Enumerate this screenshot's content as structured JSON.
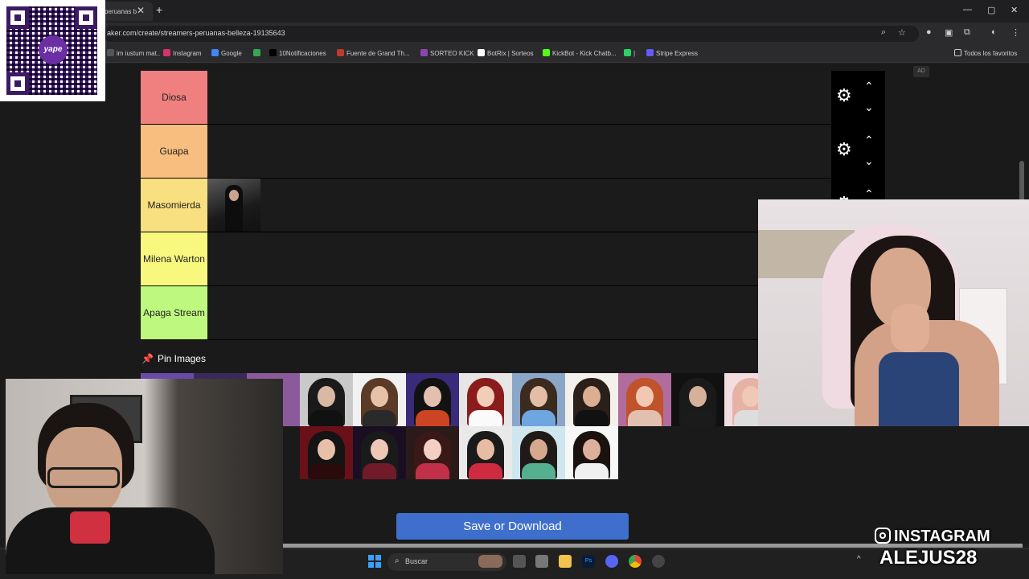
{
  "browser": {
    "tab_title": "peruanas b",
    "url": "aker.com/create/streamers-peruanas-belleza-19135643",
    "bookmarks": [
      {
        "label": "im iustum mat..",
        "color": "#555555"
      },
      {
        "label": "Instagram",
        "color": "#d6336c"
      },
      {
        "label": "Google",
        "color": "#4285f4"
      },
      {
        "label": "",
        "color": "#34a853"
      },
      {
        "label": "10Notificaciones",
        "color": "#000000"
      },
      {
        "label": "Fuente de Grand Th...",
        "color": "#c0392b"
      },
      {
        "label": "SORTEO KICK",
        "color": "#8e44ad"
      },
      {
        "label": "BotRix | Sorteos",
        "color": "#ffffff"
      },
      {
        "label": "KickBot - Kick Chatb...",
        "color": "#53fc18"
      },
      {
        "label": "|",
        "color": "#25d366"
      },
      {
        "label": "Stripe Express",
        "color": "#635bff"
      }
    ],
    "favorites_label": "Todos los favoritos"
  },
  "qr": {
    "logo_text": "yape"
  },
  "ad_label": "AD",
  "tiers": [
    {
      "label": "Diosa",
      "color": "#f07f7f"
    },
    {
      "label": "Guapa",
      "color": "#f8be7f"
    },
    {
      "label": "Masomierda",
      "color": "#f8df7f"
    },
    {
      "label": "Milena Warton",
      "color": "#f8f87f"
    },
    {
      "label": "Apaga Stream",
      "color": "#bef87f"
    }
  ],
  "pin_label": "Pin Images",
  "save_label": "Save or Download",
  "taskbar": {
    "search_placeholder": "Buscar"
  },
  "overlay": {
    "instagram_label": "INSTAGRAM",
    "handle": "ALEJUS28"
  },
  "icons": {
    "gear": "gear-icon",
    "up": "chevron-up-icon",
    "down": "chevron-down-icon",
    "pin": "pin-icon",
    "search": "search-icon"
  }
}
